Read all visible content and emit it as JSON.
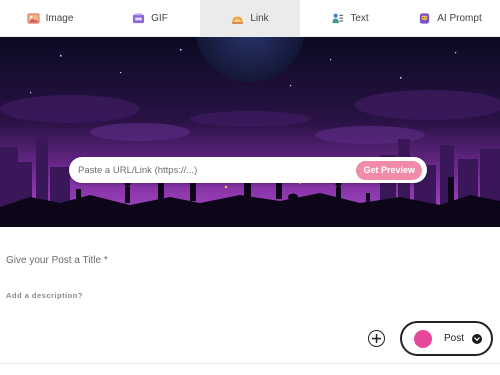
{
  "tabs": [
    {
      "label": "Image",
      "icon": "image-icon",
      "active": false
    },
    {
      "label": "GIF",
      "icon": "gif-icon",
      "active": false
    },
    {
      "label": "Link",
      "icon": "link-icon",
      "active": true
    },
    {
      "label": "Text",
      "icon": "text-icon",
      "active": false
    },
    {
      "label": "AI Prompt",
      "icon": "ai-prompt-icon",
      "active": false
    }
  ],
  "link": {
    "placeholder": "Paste a URL/Link (https://...)",
    "preview_label": "Get Preview"
  },
  "post_title": {
    "placeholder": "Give your Post a Title *"
  },
  "description": {
    "placeholder": "Add a description?"
  },
  "post_button": {
    "label": "Post"
  },
  "colors": {
    "accent_pink": "#f08ca8",
    "post_dot": "#e5489a",
    "banner_purple": "#9b3fc8"
  }
}
